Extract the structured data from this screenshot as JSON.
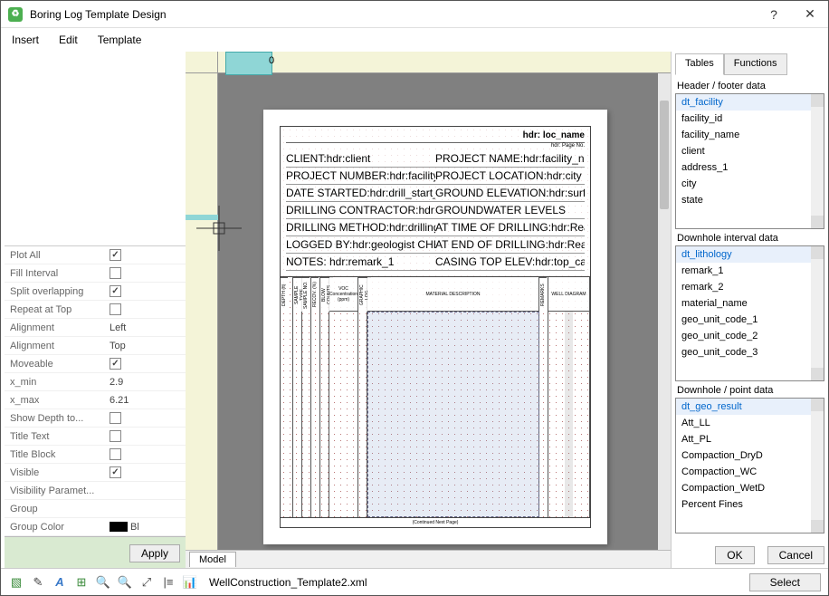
{
  "window": {
    "title": "Boring Log Template Design"
  },
  "menu": {
    "insert": "Insert",
    "edit": "Edit",
    "template": "Template"
  },
  "ruler": {
    "zero": "0"
  },
  "properties": [
    {
      "name": "Plot All",
      "type": "check",
      "checked": true
    },
    {
      "name": "Fill Interval",
      "type": "check",
      "checked": false
    },
    {
      "name": "Split overlapping",
      "type": "check",
      "checked": true
    },
    {
      "name": "Repeat at Top",
      "type": "check",
      "checked": false
    },
    {
      "name": "Alignment",
      "type": "text",
      "value": "Left"
    },
    {
      "name": "Alignment",
      "type": "text",
      "value": "Top"
    },
    {
      "name": "Moveable",
      "type": "check",
      "checked": true
    },
    {
      "name": "x_min",
      "type": "text",
      "value": "2.9"
    },
    {
      "name": "x_max",
      "type": "text",
      "value": "6.21"
    },
    {
      "name": "Show Depth to...",
      "type": "check",
      "checked": false
    },
    {
      "name": "Title Text",
      "type": "check",
      "checked": false
    },
    {
      "name": "Title Block",
      "type": "check",
      "checked": false
    },
    {
      "name": "Visible",
      "type": "check",
      "checked": true
    },
    {
      "name": "Visibility  Paramet...",
      "type": "text",
      "value": ""
    },
    {
      "name": "Group",
      "type": "text",
      "value": ""
    },
    {
      "name": "Group Color",
      "type": "color",
      "value": "Bl"
    }
  ],
  "apply_btn": "Apply",
  "canvas": {
    "tab": "Model",
    "page": {
      "loc_name": "hdr: loc_name",
      "page_no": "hdr: Page No.",
      "lines": {
        "client": "CLIENT:hdr:client",
        "proj_name": "PROJECT NAME:hdr:facility_name",
        "proj_num": "PROJECT NUMBER:hdr:facility_id",
        "proj_loc": "PROJECT LOCATION:hdr:city",
        "date_start": "DATE STARTED:hdr:drill_start_date COMPLETED:hdr:drill_end_date",
        "ground_elev": "GROUND ELEVATION:hdr:surface_elev HOLE SIZE:hdr:drill_diameter_unit",
        "contractor": "DRILLING CONTRACTOR:hdr:driller",
        "gw_levels": "GROUNDWATER LEVELS",
        "method": "DRILLING METHOD:hdr:drilling_method",
        "at_drill": "AT TIME OF DRILLING:hdr:Reading First_dep",
        "logged": "LOGGED BY:hdr:geologist      CHECKED BY:hdr:inspector",
        "at_end": "AT END OF DRILLING:hdr:Reading Last_dep",
        "notes": "NOTES: hdr:remark_1",
        "casing": "CASING TOP ELEV:hdr:top_casing_elev"
      },
      "col_headers": [
        "DEPTH (ft)",
        "SAMPLE TYPE",
        "SAMPLE NO.",
        "RECOV. (%)",
        "BLOW COUNTS",
        "VOC Concentration (ppm)",
        "GRAPHIC LOG",
        "MATERIAL DESCRIPTION",
        "REMARKS",
        "WELL DIAGRAM"
      ],
      "footer": "(Continued Next Page)"
    }
  },
  "right": {
    "tabs": {
      "tables": "Tables",
      "functions": "Functions"
    },
    "panel1": {
      "title": "Header / footer data",
      "items": [
        "dt_facility",
        "facility_id",
        "facility_name",
        "client",
        "address_1",
        "city",
        "state"
      ]
    },
    "panel2": {
      "title": "Downhole interval data",
      "items": [
        "dt_lithology",
        "remark_1",
        "remark_2",
        "material_name",
        "geo_unit_code_1",
        "geo_unit_code_2",
        "geo_unit_code_3"
      ]
    },
    "panel3": {
      "title": "Downhole / point data",
      "items": [
        "dt_geo_result",
        "Att_LL",
        "Att_PL",
        "Compaction_DryD",
        "Compaction_WC",
        "Compaction_WetD",
        "Percent Fines"
      ]
    },
    "ok": "OK",
    "cancel": "Cancel"
  },
  "status": {
    "filename": "WellConstruction_Template2.xml",
    "select": "Select"
  }
}
